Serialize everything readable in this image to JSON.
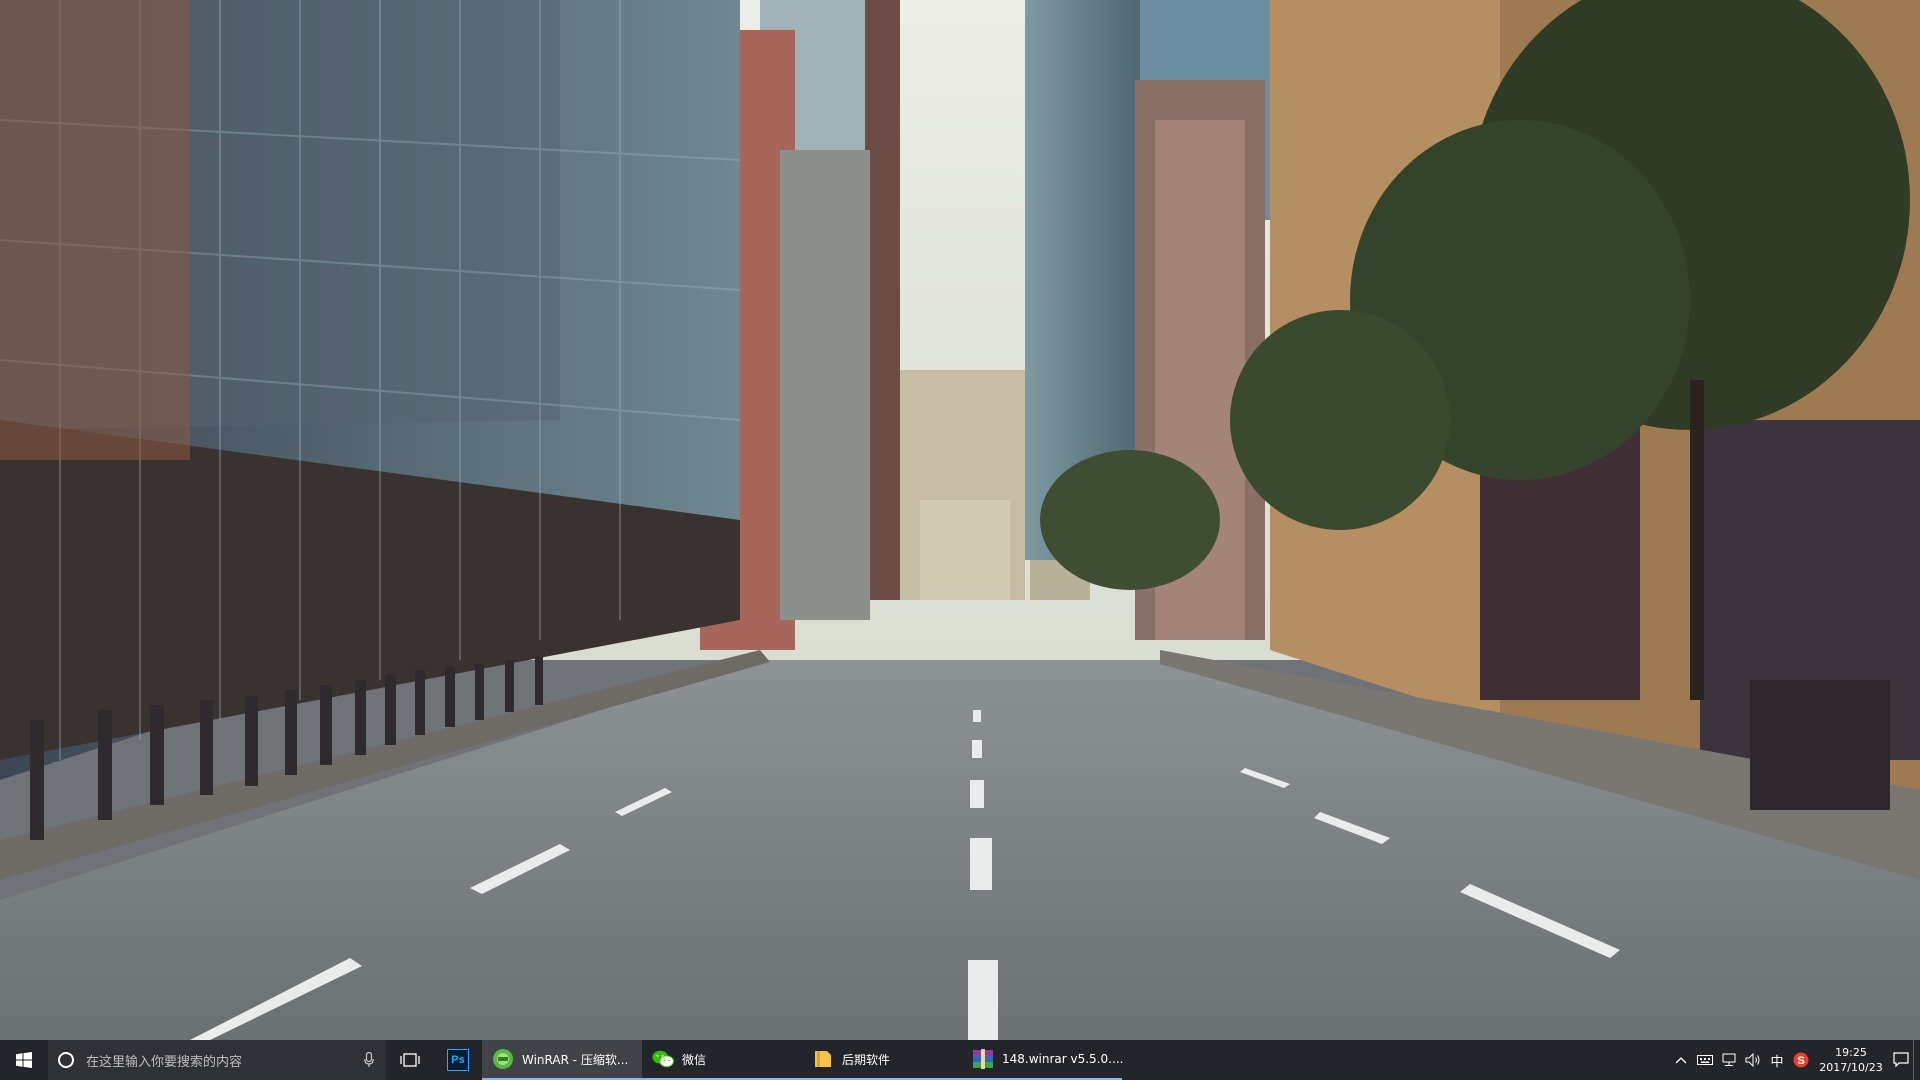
{
  "colors": {
    "taskbar_bg": "#1c1e24",
    "active_underline": "#8fb6e0",
    "ps_blue": "#31a8ff",
    "wechat_green": "#2dc100",
    "sogou_red": "#e2432a"
  },
  "taskbar": {
    "start_icon": "windows-logo-icon",
    "search": {
      "placeholder": "在这里输入你要搜索的内容",
      "mic_icon": "microphone-icon"
    },
    "taskview_icon": "task-view-icon",
    "apps": [
      {
        "label": "",
        "icon": "photoshop-icon",
        "icon_text": "Ps",
        "state": "pinned"
      },
      {
        "label": "WinRAR - 压缩软...",
        "icon": "winrar-icon",
        "state": "active"
      },
      {
        "label": "微信",
        "icon": "wechat-icon",
        "state": "running"
      },
      {
        "label": "后期软件",
        "icon": "folder-icon",
        "state": "running"
      },
      {
        "label": "148.winrar v5.5.0....",
        "icon": "winrar-archive-icon",
        "state": "running"
      }
    ],
    "tray": {
      "icons": [
        "chevron-up-icon",
        "keyboard-icon",
        "network-icon",
        "volume-icon"
      ],
      "ime": "中",
      "sogou_icon": "sogou-icon",
      "time": "19:25",
      "date": "2017/10/23",
      "notification_icon": "action-center-icon"
    }
  }
}
